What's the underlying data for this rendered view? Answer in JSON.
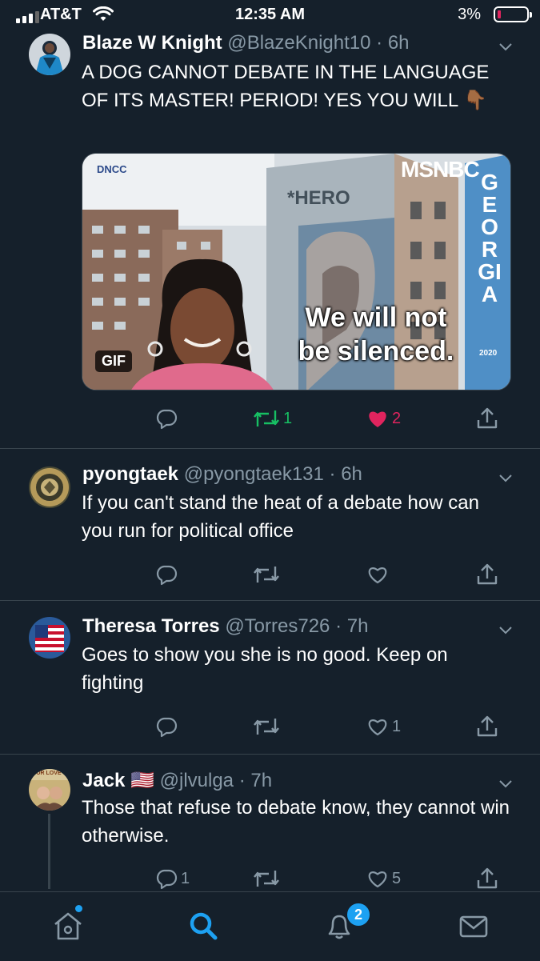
{
  "status_bar": {
    "carrier": "AT&T",
    "time": "12:35 AM",
    "battery": "3%",
    "battery_level": 0.03
  },
  "tweets": [
    {
      "name": "Blaze W Knight",
      "handle": "@BlazeKnight10",
      "time": "6h",
      "text": "A DOG CANNOT DEBATE IN THE LANGUAGE OF ITS MASTER! PERIOD! YES YOU WILL 👇🏾",
      "media": {
        "type": "gif",
        "badge": "GIF",
        "logo_text": "DNCC",
        "network": "MSNBC",
        "mural_text": "*HERO",
        "banner_text": "GEORGIA",
        "caption_line1": "We will not",
        "caption_line2": "be silenced.",
        "corner_text": "2020"
      },
      "replies": "",
      "retweets": "1",
      "likes": "2",
      "liked": true,
      "retweeted": true
    },
    {
      "name": "pyongtaek",
      "handle": "@pyongtaek131",
      "time": "6h",
      "text": "If you can't stand the heat of a debate how can you run for political office",
      "replies": "",
      "retweets": "",
      "likes": ""
    },
    {
      "name": "Theresa Torres",
      "handle": "@Torres726",
      "time": "7h",
      "text": "Goes to show you she is no good. Keep on fighting",
      "replies": "",
      "retweets": "",
      "likes": "1"
    },
    {
      "name": "Jack",
      "flag": "🇺🇸",
      "handle": "@jlvulga",
      "time": "7h",
      "text": "Those that refuse to debate know, they cannot win otherwise.",
      "replies": "1",
      "retweets": "",
      "likes": "5",
      "avatar_text": "OUR LOVE"
    }
  ],
  "tabbar": {
    "items": [
      "home",
      "search",
      "notifications",
      "messages"
    ],
    "active": "search",
    "notifications_badge": "2"
  },
  "colors": {
    "background": "#15202b",
    "muted": "#8899a6",
    "accent": "#1da1f2",
    "retweet": "#17bf63",
    "like": "#e0245e"
  }
}
